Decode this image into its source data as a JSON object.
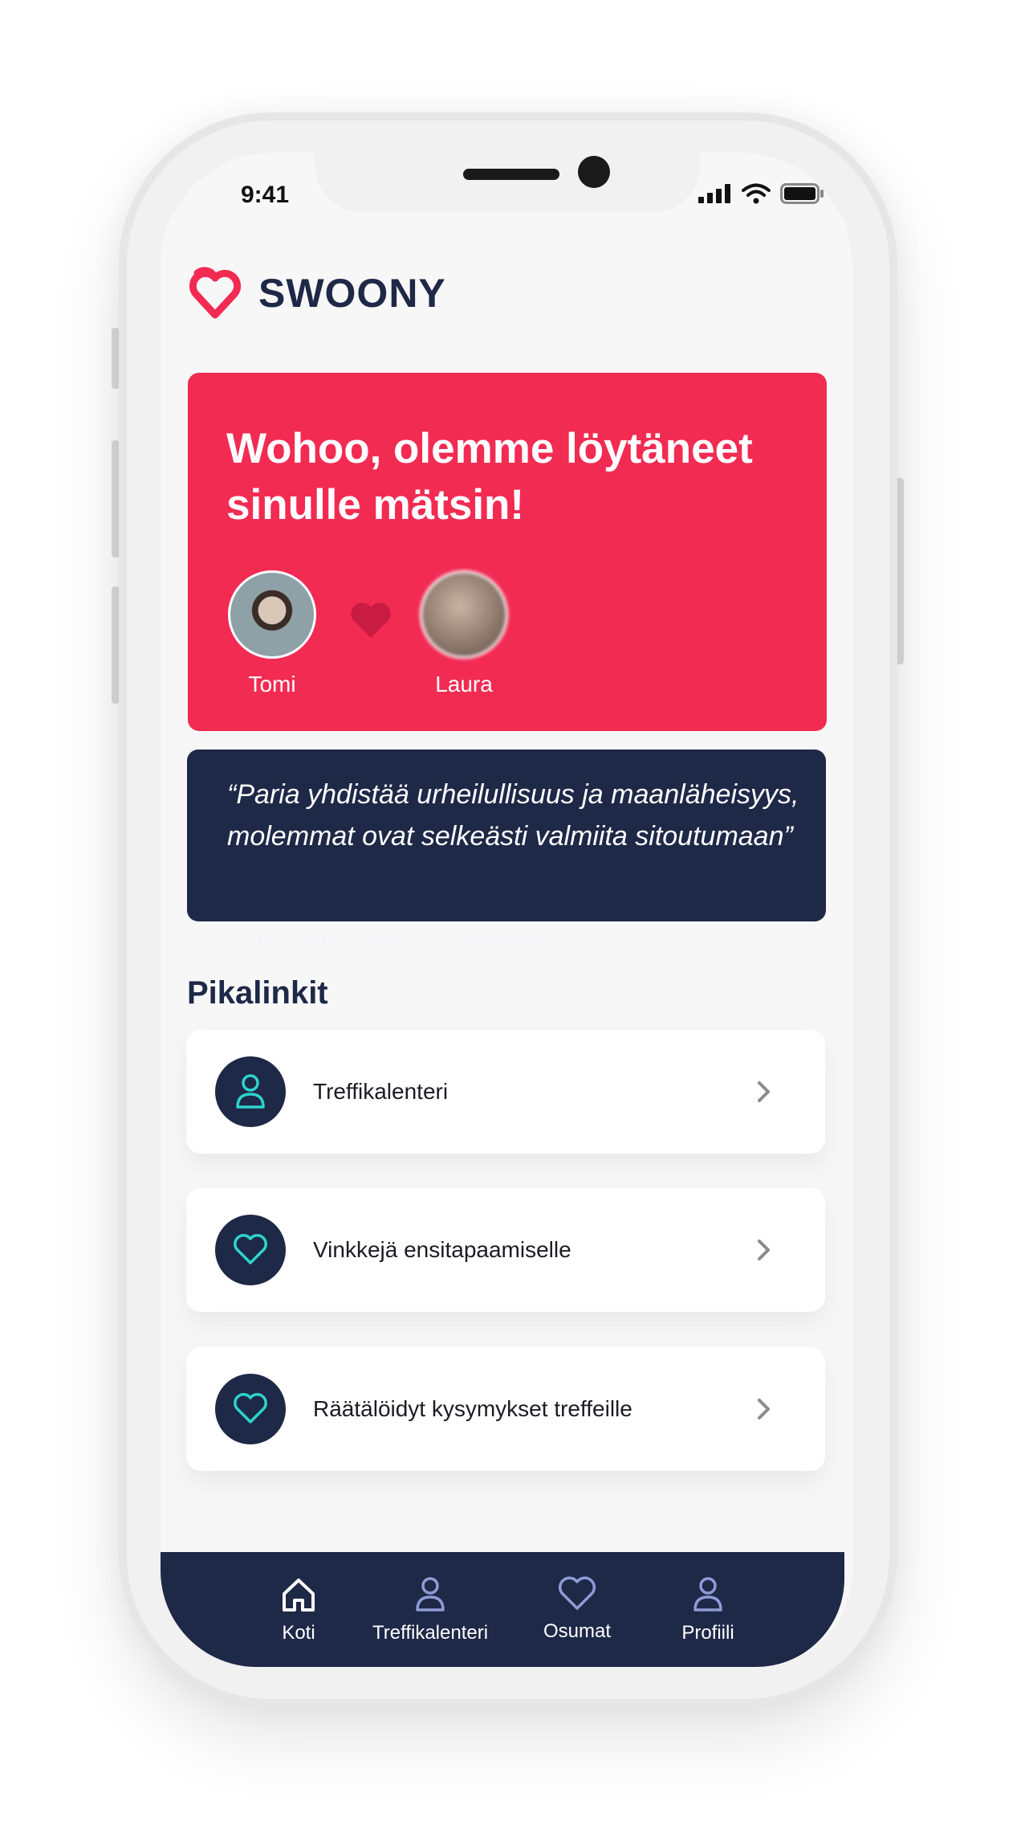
{
  "status_bar": {
    "time": "9:41"
  },
  "brand": {
    "name": "SWOONY",
    "accent": "#f22b53",
    "navy": "#1e2847",
    "teal": "#2ed3cc"
  },
  "match_card": {
    "title": "Wohoo, olemme löytäneet sinulle mätsin!",
    "person_left": "Tomi",
    "person_right": "Laura"
  },
  "quote": {
    "text": "“Paria yhdistää urheilullisuus ja maanläheisyys, molemmat ovat selkeästi valmiita sitoutumaan”",
    "faint_link": "Katso yhteistyökumppanimme"
  },
  "quick_links": {
    "title": "Pikalinkit",
    "items": [
      {
        "label": "Treffikalenteri",
        "icon": "person-icon"
      },
      {
        "label": "Vinkkejä ensitapaamiselle",
        "icon": "heart-icon"
      },
      {
        "label": "Räätälöidyt kysymykset treffeille",
        "icon": "heart-icon"
      }
    ]
  },
  "bottom_nav": {
    "items": [
      {
        "label": "Koti",
        "icon": "home-icon"
      },
      {
        "label": "Treffikalenteri",
        "icon": "person-icon"
      },
      {
        "label": "Osumat",
        "icon": "heart-icon"
      },
      {
        "label": "Profiili",
        "icon": "person-icon"
      }
    ]
  }
}
